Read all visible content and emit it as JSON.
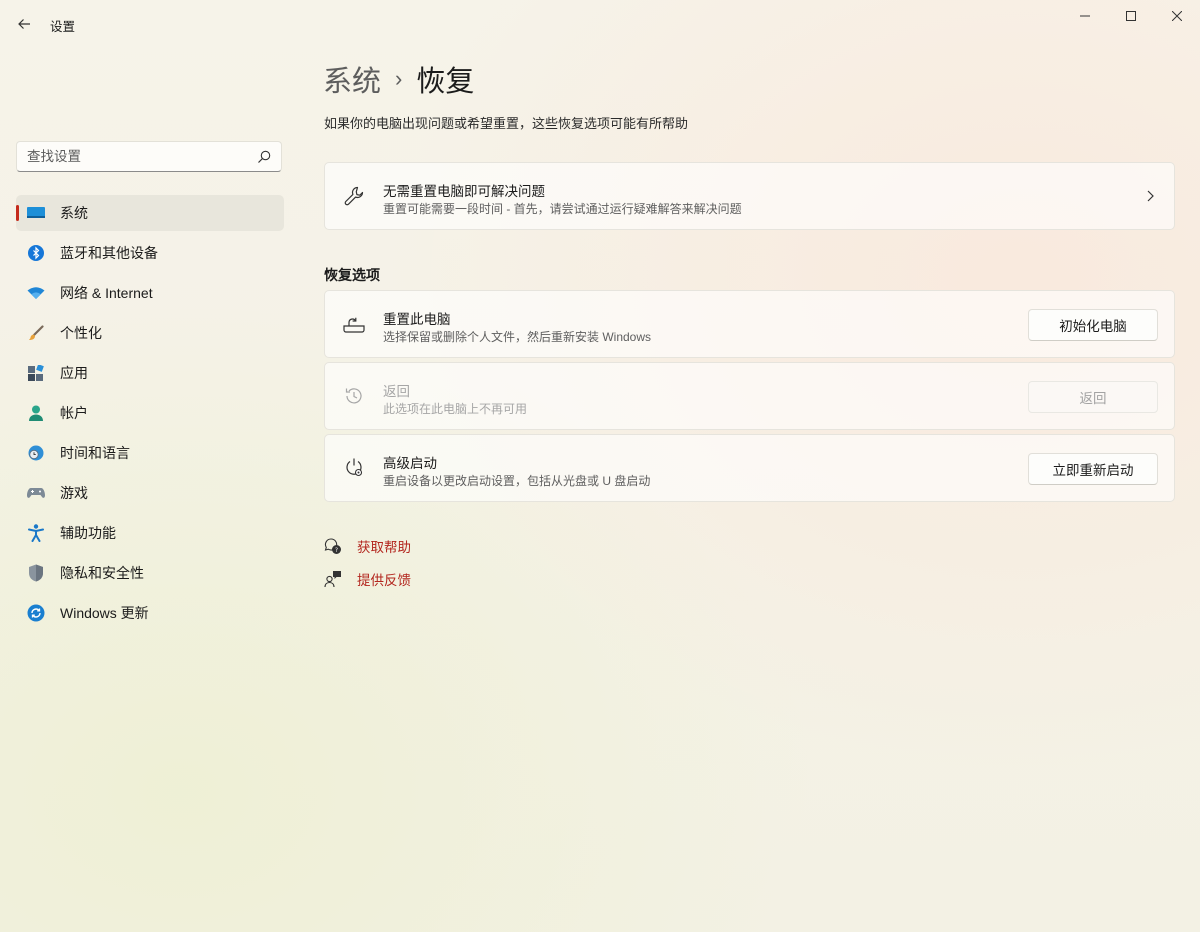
{
  "window": {
    "title": "设置",
    "controls": {
      "minimize": "minimize-icon",
      "maximize": "maximize-icon",
      "close": "close-icon"
    }
  },
  "search": {
    "placeholder": "查找设置",
    "value": ""
  },
  "sidebar": {
    "items": [
      {
        "label": "系统",
        "icon": "system-display-icon",
        "active": true
      },
      {
        "label": "蓝牙和其他设备",
        "icon": "bluetooth-icon"
      },
      {
        "label": "网络 & Internet",
        "icon": "wifi-icon"
      },
      {
        "label": "个性化",
        "icon": "brush-icon"
      },
      {
        "label": "应用",
        "icon": "apps-icon"
      },
      {
        "label": "帐户",
        "icon": "account-icon"
      },
      {
        "label": "时间和语言",
        "icon": "globe-clock-icon"
      },
      {
        "label": "游戏",
        "icon": "gamepad-icon"
      },
      {
        "label": "辅助功能",
        "icon": "accessibility-icon"
      },
      {
        "label": "隐私和安全性",
        "icon": "shield-icon"
      },
      {
        "label": "Windows 更新",
        "icon": "windows-update-icon"
      }
    ]
  },
  "header": {
    "breadcrumb_parent": "系统",
    "breadcrumb_separator": "›",
    "breadcrumb_current": "恢复",
    "subtitle": "如果你的电脑出现问题或希望重置，这些恢复选项可能有所帮助"
  },
  "troubleshoot": {
    "title": "无需重置电脑即可解决问题",
    "description": "重置可能需要一段时间 - 首先，请尝试通过运行疑难解答来解决问题",
    "icon": "wrench-icon"
  },
  "recovery": {
    "section_title": "恢复选项",
    "options": [
      {
        "title": "重置此电脑",
        "description": "选择保留或删除个人文件，然后重新安装 Windows",
        "button": "初始化电脑",
        "icon": "reset-pc-icon",
        "enabled": true
      },
      {
        "title": "返回",
        "description": "此选项在此电脑上不再可用",
        "button": "返回",
        "icon": "history-icon",
        "enabled": false
      },
      {
        "title": "高级启动",
        "description": "重启设备以更改启动设置，包括从光盘或 U 盘启动",
        "button": "立即重新启动",
        "icon": "advanced-startup-icon",
        "enabled": true
      }
    ]
  },
  "links": {
    "help": "获取帮助",
    "feedback": "提供反馈"
  },
  "colors": {
    "accent_red": "#c42b1c",
    "link_red": "#b3261e"
  }
}
